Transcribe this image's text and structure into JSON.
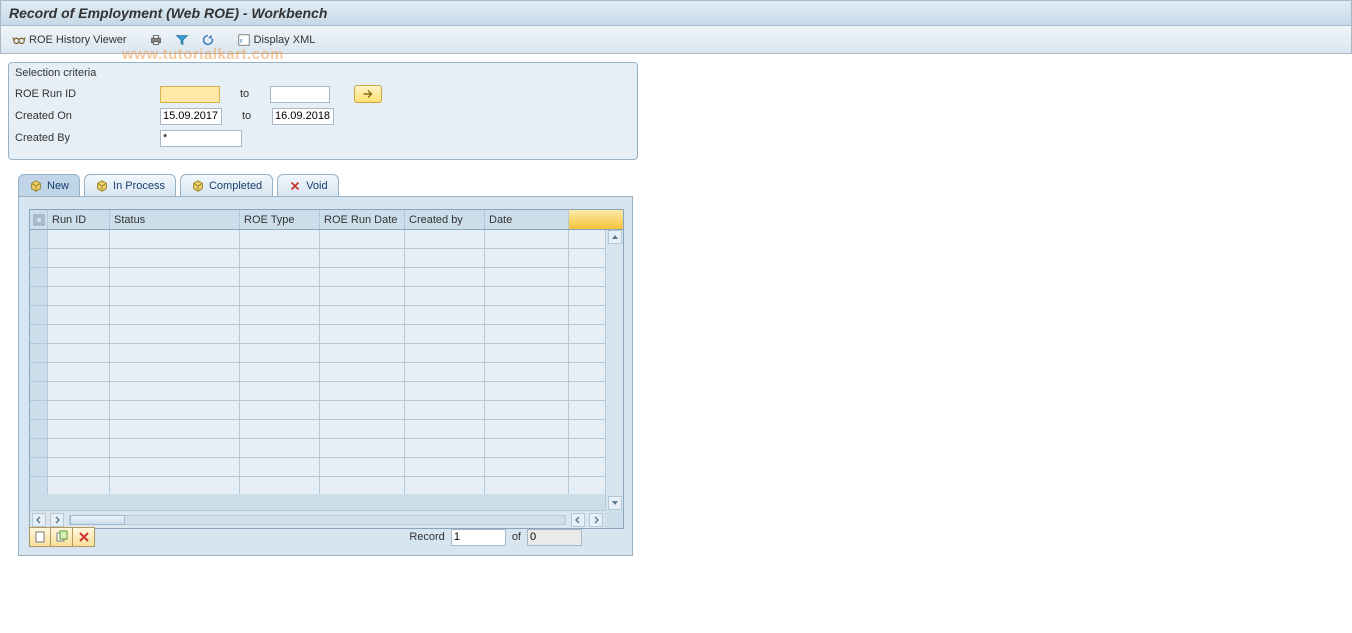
{
  "header": {
    "title": "Record of Employment (Web ROE) - Workbench"
  },
  "toolbar": {
    "roe_history": "ROE History Viewer",
    "display_xml": "Display XML"
  },
  "watermark": "www.tutorialkart.com",
  "selection": {
    "title": "Selection criteria",
    "runid_label": "ROE Run ID",
    "runid_from": "",
    "runid_to": "",
    "to_label": "to",
    "createdon_label": "Created On",
    "createdon_from": "15.09.2017",
    "createdon_to": "16.09.2018",
    "createdby_label": "Created By",
    "createdby_value": "*"
  },
  "tabs": {
    "new": "New",
    "inprocess": "In Process",
    "completed": "Completed",
    "void": "Void"
  },
  "grid": {
    "headers": {
      "runid": "Run ID",
      "status": "Status",
      "roetype": "ROE Type",
      "rundate": "ROE Run Date",
      "createdby": "Created by",
      "date": "Date"
    }
  },
  "footer": {
    "record_label": "Record",
    "current": "1",
    "of_label": "of",
    "total": "0"
  }
}
